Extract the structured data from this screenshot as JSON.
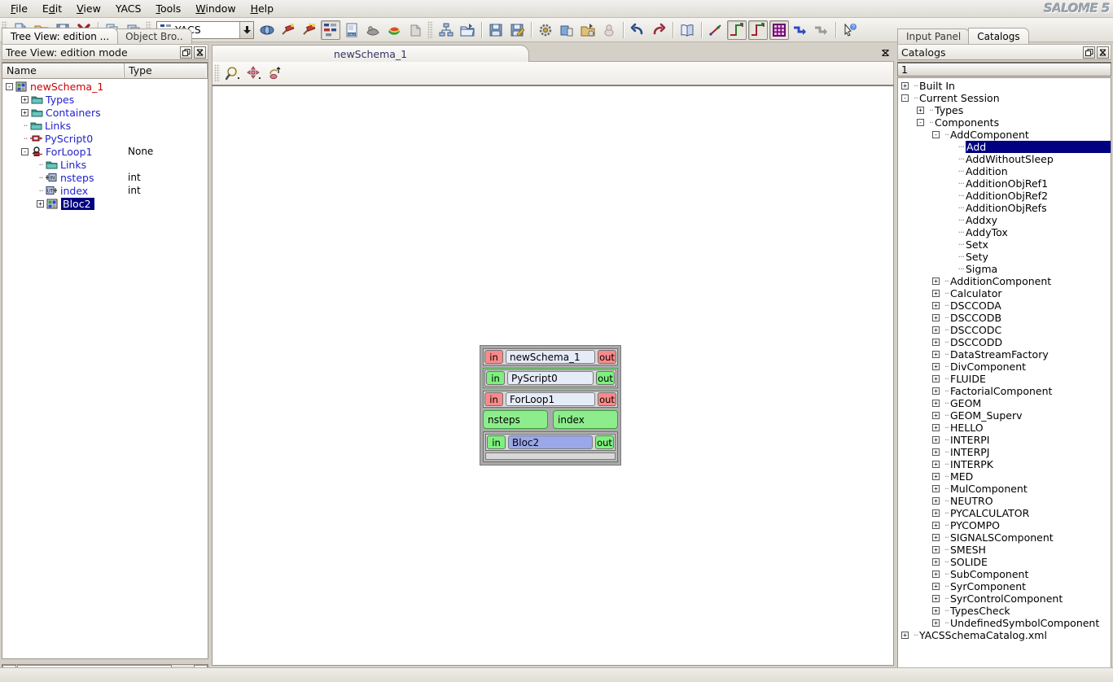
{
  "app": {
    "logo": "SALOME 5"
  },
  "menubar": {
    "items": [
      "File",
      "Edit",
      "View",
      "YACS",
      "Tools",
      "Window",
      "Help"
    ]
  },
  "toolbar": {
    "module_combo": {
      "value": "YACS",
      "icon": "yacs-module-icon",
      "arrow": "⬇"
    },
    "groups": [
      {
        "name": "file",
        "buttons": [
          {
            "name": "new-document-button",
            "icon": "new-document-icon"
          },
          {
            "name": "open-document-button",
            "icon": "open-folder-icon"
          },
          {
            "name": "save-document-button",
            "icon": "floppy-save-icon"
          },
          {
            "name": "close-document-button",
            "icon": "red-x-icon"
          }
        ]
      },
      {
        "name": "clipboard",
        "buttons": [
          {
            "name": "copy-button",
            "icon": "copy-icon"
          },
          {
            "name": "paste-button",
            "icon": "paste-icon"
          }
        ]
      },
      {
        "name": "modules",
        "buttons": [
          {
            "name": "geometry-module-button",
            "icon": "geometry-icon"
          },
          {
            "name": "mesh-module-button",
            "icon": "mesh-pin-icon"
          },
          {
            "name": "mesh2-module-button",
            "icon": "mesh-pin2-icon"
          },
          {
            "name": "yacs-module-button",
            "icon": "yacs-icon"
          },
          {
            "name": "med-module-button",
            "icon": "med-doc-icon"
          },
          {
            "name": "smesh-module-button",
            "icon": "smesh-icon"
          },
          {
            "name": "post-pro-module-button",
            "icon": "rainbow-icon"
          },
          {
            "name": "paravis-module-button",
            "icon": "paravis-icon"
          }
        ]
      },
      {
        "name": "yacs-file",
        "buttons": [
          {
            "name": "new-schema-button",
            "icon": "schema-tree-icon"
          },
          {
            "name": "import-schema-button",
            "icon": "open-schema-icon"
          }
        ]
      },
      {
        "name": "yacs-save",
        "buttons": [
          {
            "name": "save-schema-button",
            "icon": "floppy-icon"
          },
          {
            "name": "save-schema-as-button",
            "icon": "floppy-pencil-icon"
          }
        ]
      },
      {
        "name": "yacs-run",
        "buttons": [
          {
            "name": "preferences-button",
            "icon": "gear-icon"
          },
          {
            "name": "run-schema-button",
            "icon": "run-batch-icon"
          },
          {
            "name": "load-run-button",
            "icon": "load-run-icon"
          },
          {
            "name": "load-batch-button",
            "icon": "batch-icon"
          }
        ]
      },
      {
        "name": "edit",
        "buttons": [
          {
            "name": "undo-button",
            "icon": "undo-arrow-icon"
          },
          {
            "name": "redo-button",
            "icon": "redo-arrow-icon"
          }
        ]
      },
      {
        "name": "catalog",
        "buttons": [
          {
            "name": "show-catalog-button",
            "icon": "book-icon"
          }
        ]
      },
      {
        "name": "links",
        "buttons": [
          {
            "name": "straight-link-button",
            "icon": "straight-link-icon"
          },
          {
            "name": "orthogonal-link-button",
            "icon": "ortho-link-icon",
            "pressed": true
          },
          {
            "name": "orthogonal-link2-button",
            "icon": "ortho-link2-icon",
            "pressed": true
          },
          {
            "name": "grid-button",
            "icon": "grid-icon",
            "pressed": true
          },
          {
            "name": "arrange-nodes-button",
            "icon": "arrange-blue-icon"
          },
          {
            "name": "arrange-nodes2-button",
            "icon": "arrange-grey-icon"
          }
        ]
      },
      {
        "name": "help",
        "buttons": [
          {
            "name": "whats-this-button",
            "icon": "cursor-help-icon"
          }
        ]
      }
    ]
  },
  "left_panel": {
    "tabs": [
      {
        "label": "Tree View: edition ...",
        "active": true,
        "name": "tab-tree-view"
      },
      {
        "label": "Object Bro..",
        "active": false,
        "name": "tab-object-browser"
      }
    ],
    "dock_title": "Tree View: edition mode",
    "dock_buttons": [
      {
        "name": "undock-button",
        "glyph": "❐"
      },
      {
        "name": "close-panel-button",
        "glyph": "✕"
      }
    ],
    "columns": [
      "Name",
      "Type"
    ],
    "tree": [
      {
        "indent": 0,
        "expander": "-",
        "icon": "schema-icon",
        "label": "newSchema_1",
        "type": "",
        "color": "#cc0000",
        "selected": false
      },
      {
        "indent": 1,
        "expander": "+",
        "icon": "folder-icon",
        "label": "Types",
        "type": "",
        "color": "#2222cc",
        "selected": false
      },
      {
        "indent": 1,
        "expander": "+",
        "icon": "folder-icon",
        "label": "Containers",
        "type": "",
        "color": "#2222cc",
        "selected": false
      },
      {
        "indent": 1,
        "expander": "",
        "icon": "folder-icon",
        "label": "Links",
        "type": "",
        "color": "#2222cc",
        "selected": false
      },
      {
        "indent": 1,
        "expander": "",
        "icon": "pyscript-icon",
        "label": "PyScript0",
        "type": "",
        "color": "#2222cc",
        "selected": false
      },
      {
        "indent": 1,
        "expander": "-",
        "icon": "forloop-icon",
        "label": "ForLoop1",
        "type": "None",
        "color": "#2222cc",
        "selected": false
      },
      {
        "indent": 2,
        "expander": "",
        "icon": "folder-icon",
        "label": "Links",
        "type": "",
        "color": "#2222cc",
        "selected": false
      },
      {
        "indent": 2,
        "expander": "",
        "icon": "inport-icon",
        "label": "nsteps",
        "type": "int",
        "color": "#2222cc",
        "selected": false
      },
      {
        "indent": 2,
        "expander": "",
        "icon": "outport-icon",
        "label": "index",
        "type": "int",
        "color": "#2222cc",
        "selected": false
      },
      {
        "indent": 2,
        "expander": "+",
        "icon": "bloc-icon",
        "label": "Bloc2",
        "type": "",
        "color": "#ffffff",
        "selected": true
      }
    ],
    "scrollbar": {
      "left_arrow": "←",
      "right_arrow": "→"
    }
  },
  "center_panel": {
    "tab": {
      "label": "newSchema_1",
      "name": "view-tab-newschema"
    },
    "close_glyph": "✕",
    "view_toolbar": [
      {
        "name": "zoom-tool-button",
        "icon": "magnifier-icon"
      },
      {
        "name": "pan-tool-button",
        "icon": "move-arrows-icon"
      },
      {
        "name": "rotate-tool-button",
        "icon": "rotate-icon"
      }
    ],
    "graph": {
      "root": {
        "label": "newSchema_1",
        "in": "in",
        "out": "out",
        "port_color": "red",
        "fill": "light"
      },
      "children": [
        {
          "kind": "script",
          "label": "PyScript0",
          "in": "in",
          "out": "out",
          "port_color": "green",
          "fill": "light"
        },
        {
          "kind": "loop",
          "label": "ForLoop1",
          "in": "in",
          "out": "out",
          "port_color": "red",
          "fill": "light",
          "pills": [
            "nsteps",
            "index"
          ],
          "inner": {
            "label": "Bloc2",
            "in": "in",
            "out": "out",
            "port_color": "green",
            "fill": "blue"
          }
        }
      ]
    }
  },
  "right_panel": {
    "tabs": [
      {
        "label": "Input Panel",
        "active": false,
        "name": "tab-input-panel"
      },
      {
        "label": "Catalogs",
        "active": true,
        "name": "tab-catalogs"
      }
    ],
    "dock_title": "Catalogs",
    "dock_buttons": [
      {
        "name": "undock-button",
        "glyph": "❐"
      },
      {
        "name": "close-panel-button",
        "glyph": "✕"
      }
    ],
    "combo_value": "1",
    "tree": [
      {
        "indent": 0,
        "expander": "+",
        "label": "Built In",
        "selected": false
      },
      {
        "indent": 0,
        "expander": "-",
        "label": "Current Session",
        "selected": false
      },
      {
        "indent": 1,
        "expander": "+",
        "label": "Types",
        "selected": false
      },
      {
        "indent": 1,
        "expander": "-",
        "label": "Components",
        "selected": false
      },
      {
        "indent": 2,
        "expander": "-",
        "label": "AddComponent",
        "selected": false
      },
      {
        "indent": 3,
        "expander": "",
        "label": "Add",
        "selected": true
      },
      {
        "indent": 3,
        "expander": "",
        "label": "AddWithoutSleep",
        "selected": false
      },
      {
        "indent": 3,
        "expander": "",
        "label": "Addition",
        "selected": false
      },
      {
        "indent": 3,
        "expander": "",
        "label": "AdditionObjRef1",
        "selected": false
      },
      {
        "indent": 3,
        "expander": "",
        "label": "AdditionObjRef2",
        "selected": false
      },
      {
        "indent": 3,
        "expander": "",
        "label": "AdditionObjRefs",
        "selected": false
      },
      {
        "indent": 3,
        "expander": "",
        "label": "Addxy",
        "selected": false
      },
      {
        "indent": 3,
        "expander": "",
        "label": "AddyTox",
        "selected": false
      },
      {
        "indent": 3,
        "expander": "",
        "label": "Setx",
        "selected": false
      },
      {
        "indent": 3,
        "expander": "",
        "label": "Sety",
        "selected": false
      },
      {
        "indent": 3,
        "expander": "",
        "label": "Sigma",
        "selected": false
      },
      {
        "indent": 2,
        "expander": "+",
        "label": "AdditionComponent",
        "selected": false
      },
      {
        "indent": 2,
        "expander": "+",
        "label": "Calculator",
        "selected": false
      },
      {
        "indent": 2,
        "expander": "+",
        "label": "DSCCODA",
        "selected": false
      },
      {
        "indent": 2,
        "expander": "+",
        "label": "DSCCODB",
        "selected": false
      },
      {
        "indent": 2,
        "expander": "+",
        "label": "DSCCODC",
        "selected": false
      },
      {
        "indent": 2,
        "expander": "+",
        "label": "DSCCODD",
        "selected": false
      },
      {
        "indent": 2,
        "expander": "+",
        "label": "DataStreamFactory",
        "selected": false
      },
      {
        "indent": 2,
        "expander": "+",
        "label": "DivComponent",
        "selected": false
      },
      {
        "indent": 2,
        "expander": "+",
        "label": "FLUIDE",
        "selected": false
      },
      {
        "indent": 2,
        "expander": "+",
        "label": "FactorialComponent",
        "selected": false
      },
      {
        "indent": 2,
        "expander": "+",
        "label": "GEOM",
        "selected": false
      },
      {
        "indent": 2,
        "expander": "+",
        "label": "GEOM_Superv",
        "selected": false
      },
      {
        "indent": 2,
        "expander": "+",
        "label": "HELLO",
        "selected": false
      },
      {
        "indent": 2,
        "expander": "+",
        "label": "INTERPI",
        "selected": false
      },
      {
        "indent": 2,
        "expander": "+",
        "label": "INTERPJ",
        "selected": false
      },
      {
        "indent": 2,
        "expander": "+",
        "label": "INTERPK",
        "selected": false
      },
      {
        "indent": 2,
        "expander": "+",
        "label": "MED",
        "selected": false
      },
      {
        "indent": 2,
        "expander": "+",
        "label": "MulComponent",
        "selected": false
      },
      {
        "indent": 2,
        "expander": "+",
        "label": "NEUTRO",
        "selected": false
      },
      {
        "indent": 2,
        "expander": "+",
        "label": "PYCALCULATOR",
        "selected": false
      },
      {
        "indent": 2,
        "expander": "+",
        "label": "PYCOMPO",
        "selected": false
      },
      {
        "indent": 2,
        "expander": "+",
        "label": "SIGNALSComponent",
        "selected": false
      },
      {
        "indent": 2,
        "expander": "+",
        "label": "SMESH",
        "selected": false
      },
      {
        "indent": 2,
        "expander": "+",
        "label": "SOLIDE",
        "selected": false
      },
      {
        "indent": 2,
        "expander": "+",
        "label": "SubComponent",
        "selected": false
      },
      {
        "indent": 2,
        "expander": "+",
        "label": "SyrComponent",
        "selected": false
      },
      {
        "indent": 2,
        "expander": "+",
        "label": "SyrControlComponent",
        "selected": false
      },
      {
        "indent": 2,
        "expander": "+",
        "label": "TypesCheck",
        "selected": false
      },
      {
        "indent": 2,
        "expander": "+",
        "label": "UndefinedSymbolComponent",
        "selected": false
      },
      {
        "indent": 0,
        "expander": "+",
        "label": "YACSSchemaCatalog.xml",
        "selected": false
      }
    ]
  },
  "colors": {
    "port_red": "#f98a8a",
    "port_green": "#7ef07e",
    "node_light": "#e6ebf8",
    "node_blue": "#9aa8ea",
    "selection": "#000080",
    "schema_red": "#cc0000",
    "tree_blue": "#2222cc"
  }
}
